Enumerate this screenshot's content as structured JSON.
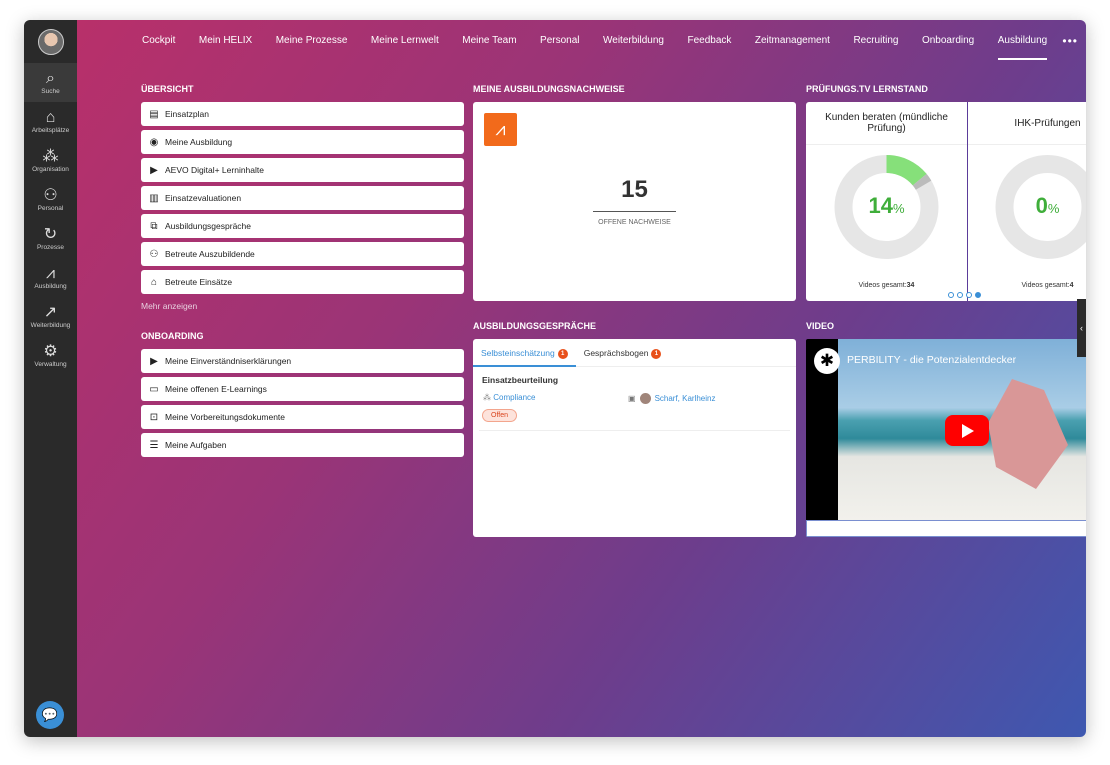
{
  "nav": [
    "Cockpit",
    "Mein HELIX",
    "Meine Prozesse",
    "Meine Lernwelt",
    "Meine Team",
    "Personal",
    "Weiterbildung",
    "Feedback",
    "Zeitmanagement",
    "Recruiting",
    "Onboarding",
    "Ausbildung"
  ],
  "nav_active": "Ausbildung",
  "sidebar": [
    {
      "label": "Suche",
      "icon": "⌕"
    },
    {
      "label": "Arbeitsplätze",
      "icon": "⌂"
    },
    {
      "label": "Organisation",
      "icon": "⁂"
    },
    {
      "label": "Personal",
      "icon": "⚇"
    },
    {
      "label": "Prozesse",
      "icon": "↻"
    },
    {
      "label": "Ausbildung",
      "icon": "⩘"
    },
    {
      "label": "Weiterbildung",
      "icon": "↗"
    },
    {
      "label": "Verwaltung",
      "icon": "⚙"
    }
  ],
  "uebersicht": {
    "title": "ÜBERSICHT",
    "items": [
      {
        "label": "Einsatzplan",
        "icon": "▤"
      },
      {
        "label": "Meine Ausbildung",
        "icon": "◉"
      },
      {
        "label": "AEVO Digital+ Lerninhalte",
        "icon": "▶"
      },
      {
        "label": "Einsatzevaluationen",
        "icon": "▥"
      },
      {
        "label": "Ausbildungsgespräche",
        "icon": "⧉"
      },
      {
        "label": "Betreute Auszubildende",
        "icon": "⚇"
      },
      {
        "label": "Betreute Einsätze",
        "icon": "⌂"
      }
    ],
    "more": "Mehr anzeigen"
  },
  "onboarding": {
    "title": "ONBOARDING",
    "items": [
      {
        "label": "Meine Einverständniserklärungen",
        "icon": "▶"
      },
      {
        "label": "Meine offenen E-Learnings",
        "icon": "▭"
      },
      {
        "label": "Meine Vorbereitungsdokumente",
        "icon": "⊡"
      },
      {
        "label": "Meine Aufgaben",
        "icon": "☰"
      }
    ]
  },
  "nachweise": {
    "title": "MEINE AUSBILDUNGSNACHWEISE",
    "count": "15",
    "label": "OFFENE NACHWEISE",
    "accent": "#f26a1b"
  },
  "lernstand": {
    "title": "PRÜFUNGS.TV LERNSTAND",
    "items": [
      {
        "title": "Kunden beraten (mündliche Prüfung)",
        "percent": 14,
        "percent_label": "14",
        "videos_label": "Videos gesamt:",
        "videos": "34"
      },
      {
        "title": "IHK-Prüfungen",
        "percent": 0,
        "percent_label": "0",
        "videos_label": "Videos gesamt:",
        "videos": "4"
      }
    ],
    "pct": "%",
    "pages": 4,
    "active_page": 4
  },
  "gespraeche": {
    "title": "AUSBILDUNGSGESPRÄCHE",
    "tabs": [
      {
        "label": "Selbsteinschätzung",
        "badge": "1"
      },
      {
        "label": "Gesprächsbogen",
        "badge": "1"
      }
    ],
    "entry": {
      "title": "Einsatzbeurteilung",
      "org": "Compliance",
      "person": "Scharf, Karlheinz",
      "status": "Offen"
    }
  },
  "video": {
    "title": "VIDEO",
    "video_title": "PERBILITY - die Potenzialentdecker"
  }
}
